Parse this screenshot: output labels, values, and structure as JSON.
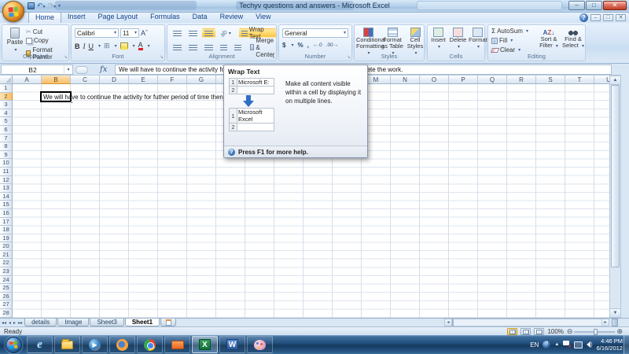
{
  "window": {
    "title": "Techyv questions and answers - Microsoft Excel"
  },
  "ribbon": {
    "tabs": [
      "Home",
      "Insert",
      "Page Layout",
      "Formulas",
      "Data",
      "Review",
      "View"
    ],
    "active_tab": "Home",
    "clipboard": {
      "label": "Clipboard",
      "paste": "Paste",
      "cut": "Cut",
      "copy": "Copy",
      "format_painter": "Format Painter"
    },
    "font": {
      "label": "Font",
      "family": "Calibri",
      "size": "11"
    },
    "alignment": {
      "label": "Alignment",
      "wrap_text": "Wrap Text",
      "merge_center": "Merge & Center"
    },
    "number": {
      "label": "Number",
      "format": "General",
      "currency": "$",
      "percent": "%",
      "comma": ","
    },
    "styles": {
      "label": "Styles",
      "conditional": "Conditional Formatting",
      "as_table": "Format as Table",
      "cell_styles": "Cell Styles"
    },
    "cells": {
      "label": "Cells",
      "insert": "Insert",
      "delete": "Delete",
      "format": "Format"
    },
    "editing": {
      "label": "Editing",
      "autosum": "AutoSum",
      "fill": "Fill",
      "clear": "Clear",
      "sort": "Sort & Filter",
      "find": "Find & Select"
    }
  },
  "formula_bar": {
    "name_box": "B2",
    "fx": "fx",
    "text": "We will have to continue the activity for futher period of time then we will be able to complete the work."
  },
  "grid": {
    "columns": [
      "A",
      "B",
      "C",
      "D",
      "E",
      "F",
      "G",
      "H",
      "I",
      "J",
      "K",
      "L",
      "M",
      "N",
      "O",
      "P",
      "Q",
      "R",
      "S",
      "T",
      "U"
    ],
    "row_count": 28,
    "selected_cell": "B2",
    "selected_column": "B",
    "selected_row": 2
  },
  "tooltip": {
    "title": "Wrap Text",
    "body": "Make all content visible within a cell by displaying it on multiple lines.",
    "footer": "Press F1 for more help.",
    "example_before": "Microsoft E:",
    "example_after_line1": "Microsoft",
    "example_after_line2": "Excel",
    "row_label_1": "1",
    "row_label_2": "2"
  },
  "sheet_tabs": {
    "tabs": [
      "details",
      "Image",
      "Sheet3",
      "Sheet1"
    ],
    "active": "Sheet1"
  },
  "status_bar": {
    "mode": "Ready",
    "zoom_level": "100%"
  },
  "taskbar": {
    "apps": [
      "ie",
      "explorer",
      "mediaplayer",
      "firefox",
      "chrome",
      "orangeapp",
      "excel",
      "word",
      "paint"
    ],
    "active_app": "excel",
    "tray": {
      "language": "EN",
      "time": "4:46 PM",
      "date": "6/16/2012"
    }
  },
  "colors": {
    "taskbar_blue": "#1f4c79",
    "selection_header": "#f6c06a",
    "wrap_text_highlight": "#fbc44a",
    "excel_green": "#13713a"
  }
}
